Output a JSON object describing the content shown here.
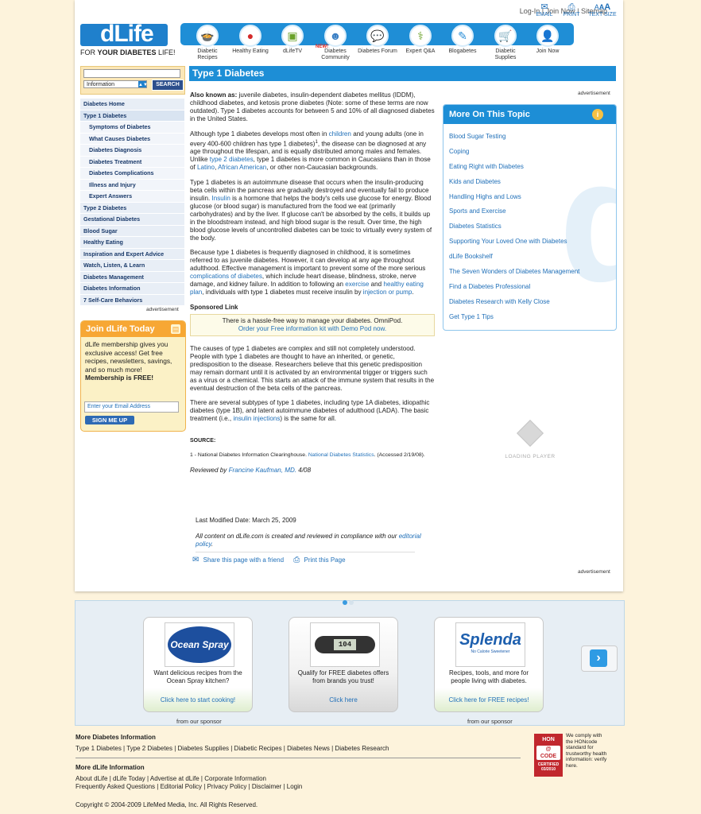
{
  "util": {
    "login": "Log-In",
    "join": "Join Now",
    "sitemap": "Sitemap",
    "email": "EMAIL",
    "print": "PRINT",
    "textsize": "TEXT SIZE"
  },
  "brand": {
    "logo": "dLife",
    "tagline_pre": "FOR ",
    "tagline_bold": "YOUR DIABETES",
    "tagline_post": " LIFE!"
  },
  "nav": [
    {
      "label": "Diabetic Recipes",
      "icon": "pot-icon"
    },
    {
      "label": "Healthy Eating",
      "icon": "apple-icon"
    },
    {
      "label": "dLifeTV",
      "icon": "tv-icon"
    },
    {
      "label": "Diabetes Community",
      "icon": "people-icon"
    },
    {
      "label": "Diabetes Forum",
      "icon": "chat-icon"
    },
    {
      "label": "Expert Q&A",
      "icon": "stethoscope-icon"
    },
    {
      "label": "Blogabetes",
      "icon": "blog-icon"
    },
    {
      "label": "Diabetic Supplies",
      "icon": "cart-icon"
    },
    {
      "label": "Join Now",
      "icon": "person-icon"
    }
  ],
  "nav_new": "NEW!",
  "search": {
    "select": "Information",
    "button": "SEARCH"
  },
  "leftnav": [
    {
      "label": "Diabetes Home",
      "sub": false
    },
    {
      "label": "Type 1 Diabetes",
      "sub": false
    },
    {
      "label": "Symptoms of Diabetes",
      "sub": true
    },
    {
      "label": "What Causes Diabetes",
      "sub": true
    },
    {
      "label": "Diabetes Diagnosis",
      "sub": true
    },
    {
      "label": "Diabetes Treatment",
      "sub": true
    },
    {
      "label": "Diabetes Complications",
      "sub": true
    },
    {
      "label": "Illness and Injury",
      "sub": true
    },
    {
      "label": "Expert Answers",
      "sub": true
    },
    {
      "label": "Type 2 Diabetes",
      "sub": false
    },
    {
      "label": "Gestational Diabetes",
      "sub": false
    },
    {
      "label": "Blood Sugar",
      "sub": false
    },
    {
      "label": "Healthy Eating",
      "sub": false
    },
    {
      "label": "Inspiration and Expert Advice",
      "sub": false
    },
    {
      "label": "Watch, Listen, & Learn",
      "sub": false
    },
    {
      "label": "Diabetes Management",
      "sub": false
    },
    {
      "label": "Diabetes Information",
      "sub": false
    },
    {
      "label": "7 Self-Care Behaviors",
      "sub": false
    }
  ],
  "advertisement": "advertisement",
  "join": {
    "title": "Join dLife Today",
    "body": "dLife membership gives you exclusive access! Get free recipes, newsletters, savings, and so much more!",
    "bold": "Membership is FREE!",
    "email_placeholder": "Enter your Email Address",
    "button": "SIGN ME UP"
  },
  "page_title": "Type 1 Diabetes",
  "article": {
    "p1_bold": "Also known as:",
    "p1": " juvenile diabetes, insulin-dependent diabetes mellitus (IDDM), childhood diabetes, and ketosis prone diabetes (Note: some of these terms are now outdated). Type 1 diabetes accounts for between 5 and 10% of all diagnosed diabetes in the United States.",
    "p2_a": "Although type 1 diabetes develops most often in ",
    "p2_link1": "children",
    "p2_b": " and young adults (one in every 400-600 children has type 1 diabetes)",
    "p2_sup": "1",
    "p2_c": ", the disease can be diagnosed at any age throughout the lifespan, and is equally distributed among males and females. Unlike ",
    "p2_link2": "type 2 diabetes",
    "p2_d": ", type 1 diabetes is more common in Caucasians than in those of ",
    "p2_link3": "Latino",
    "p2_e": ", ",
    "p2_link4": "African American",
    "p2_f": ", or other non-Caucasian backgrounds.",
    "p3_a": "Type 1 diabetes is an autoimmune disease that occurs when the insulin-producing beta cells within the pancreas are gradually destroyed and eventually fail to produce insulin. ",
    "p3_link": "Insulin",
    "p3_b": " is a hormone that helps the body's cells use glucose for energy. Blood glucose (or blood sugar) is manufactured from the food we eat (primarily carbohydrates) and by the liver. If glucose can't be absorbed by the cells, it builds up in the bloodstream instead, and high blood sugar is the result. Over time, the high blood glucose levels of uncontrolled diabetes can be toxic to virtually every system of the body.",
    "p4_a": "Because type 1 diabetes is frequently diagnosed in childhood, it is sometimes referred to as juvenile diabetes. However, it can develop at any age throughout adulthood. Effective management is important to prevent some of the more serious ",
    "p4_link1": "complications of diabetes",
    "p4_b": ", which include heart disease, blindness, stroke, nerve damage, and kidney failure. In addition to following an ",
    "p4_link2": "exercise",
    "p4_c": " and ",
    "p4_link3": "healthy eating plan",
    "p4_d": ", individuals with type 1 diabetes must receive insulin by ",
    "p4_link4": "injection or pump",
    "p4_e": ".",
    "sponsored_heading": "Sponsored Link",
    "sponsored_line1": "There is a hassle-free way to manage your diabetes. OmniPod.",
    "sponsored_line2": "Order your Free information kit with Demo Pod now.",
    "p5": "The causes of type 1 diabetes are complex and still not completely understood. People with type 1 diabetes are thought to have an inherited, or genetic, predisposition to the disease. Researchers believe that this genetic predisposition may remain dormant until it is activated by an environmental trigger or triggers such as a virus or a chemical. This starts an attack of the immune system that results in the eventual destruction of the beta cells of the pancreas.",
    "p6_a": "There are several subtypes of type 1 diabetes, including type 1A diabetes, idiopathic diabetes (type 1B), and latent autoimmune diabetes of adulthood (LADA). The basic treatment (i.e., ",
    "p6_link": "insulin injections",
    "p6_b": ") is the same for all.",
    "source_heading": "SOURCE:",
    "source_a": "1 - National Diabetes Information Clearinghouse. ",
    "source_link": "National Diabetes Statistics",
    "source_b": ". (Accessed 2/19/08).",
    "reviewed_a": "Reviewed by ",
    "reviewed_link": "Francine Kaufman, MD.",
    "reviewed_b": " 4/08",
    "last_modified": "Last Modified Date: March 25, 2009",
    "compliance_a": "All content on dLife.com is created and reviewed in compliance with our ",
    "compliance_link": "editorial policy",
    "compliance_b": ".",
    "share": "Share this page with a friend",
    "print": "Print this Page"
  },
  "more_topic": {
    "title": "More On This Topic",
    "items": [
      "Blood Sugar Testing",
      "Coping",
      "Eating Right with Diabetes",
      "Kids and Diabetes",
      "Handling Highs and Lows",
      "Sports and Exercise",
      "Diabetes Statistics",
      "Supporting Your Loved One with Diabetes",
      "dLife Bookshelf",
      "The Seven Wonders of Diabetes Management",
      "Find a Diabetes Professional",
      "Diabetes Research with Kelly Close",
      "Get Type 1 Tips"
    ]
  },
  "player": "LOADING PLAYER",
  "sponsors": [
    {
      "brand": "Ocean Spray",
      "text": "Want delicious recipes from the Ocean Spray kitchen?",
      "link": "Click here to start cooking!"
    },
    {
      "brand": "104",
      "text": "Qualify for FREE diabetes offers from brands you trust!",
      "link": "Click here"
    },
    {
      "brand": "Splenda",
      "brand_sub": "No Calorie Sweetener",
      "text": "Recipes, tools, and more for people living with diabetes.",
      "link": "Click here for FREE recipes!"
    }
  ],
  "from_sponsor": "from our sponsor",
  "footer": {
    "more_info_heading": "More Diabetes Information",
    "more_info_links": "Type 1 Diabetes | Type 2 Diabetes | Diabetes Supplies | Diabetic Recipes | Diabetes News | Diabetes Research",
    "more_dlife_heading": "More dLife Information",
    "more_dlife_line1": "About dLife | dLife Today | Advertise at dLife | Corporate Information",
    "more_dlife_line2": "Frequently Asked Questions | Editorial Policy | Privacy Policy | Disclaimer | Login",
    "copyright": "Copyright © 2004-2009 LifeMed Media, Inc. All Rights Reserved.",
    "hon_badge_top": "HON",
    "hon_badge_mid": "CODE",
    "hon_badge_cert": "CERTIFIED 03/2010",
    "hon_text": "We comply with the HONcode standard for trustworthy health information: verify here."
  }
}
